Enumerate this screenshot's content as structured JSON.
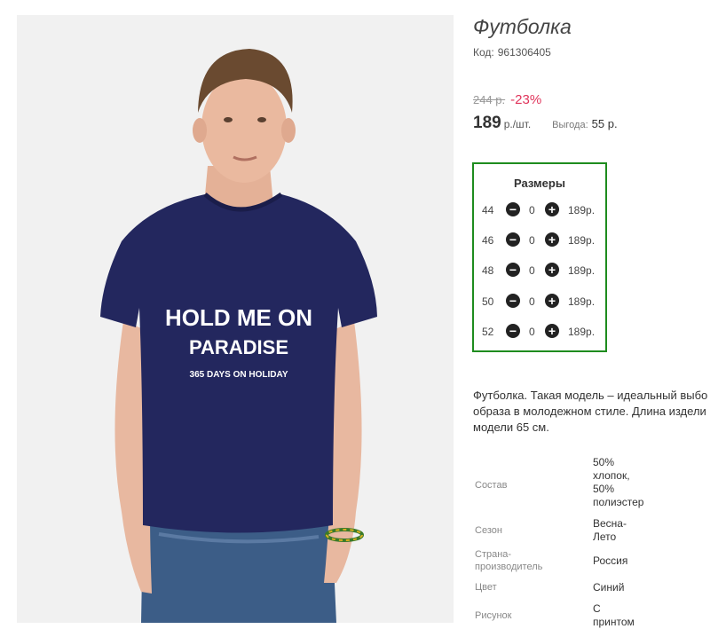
{
  "product": {
    "title": "Футболка",
    "code_label": "Код:",
    "code_value": "961306405",
    "old_price": "244 р.",
    "discount": "-23%",
    "price": "189",
    "price_unit": "р./шт.",
    "benefit_label": "Выгода:",
    "benefit_value": "55 р.",
    "shirt_print": {
      "line1": "HOLD ME ON",
      "line2": "PARADISE",
      "line3": "365 DAYS ON HOLIDAY"
    }
  },
  "sizes": {
    "title": "Размеры",
    "items": [
      {
        "size": "44",
        "minus": "−",
        "qty": "0",
        "plus": "+",
        "price": "189р."
      },
      {
        "size": "46",
        "minus": "−",
        "qty": "0",
        "plus": "+",
        "price": "189р."
      },
      {
        "size": "48",
        "minus": "−",
        "qty": "0",
        "plus": "+",
        "price": "189р."
      },
      {
        "size": "50",
        "minus": "−",
        "qty": "0",
        "plus": "+",
        "price": "189р."
      },
      {
        "size": "52",
        "minus": "−",
        "qty": "0",
        "plus": "+",
        "price": "189р."
      }
    ]
  },
  "description": "Футболка. Такая модель – идеальный выбо\nобраза в молодежном стиле. Длина издели\nмодели 65 см.",
  "attributes": [
    {
      "label": "Состав",
      "value": "50%\nхлопок,\n50%\nполиэстер"
    },
    {
      "label": "Сезон",
      "value": "Весна-\nЛето"
    },
    {
      "label": "Страна-\nпроизводитель",
      "value": "Россия"
    },
    {
      "label": "Цвет",
      "value": "Синий"
    },
    {
      "label": "Рисунок",
      "value": "С\nпринтом"
    }
  ],
  "colors": {
    "sizes_border": "#1e8c1e",
    "discount": "#e0345b",
    "shirt": "#23275e"
  }
}
